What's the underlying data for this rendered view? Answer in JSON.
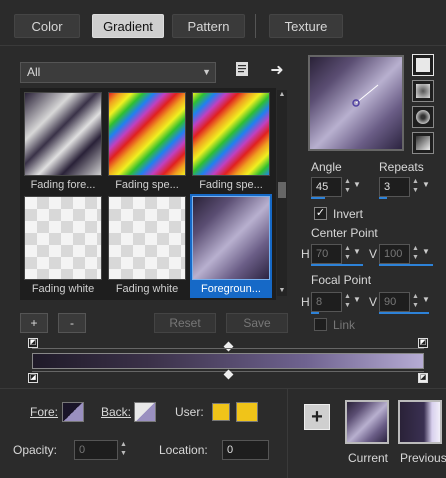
{
  "tabs": [
    "Color",
    "Gradient",
    "Pattern",
    "Texture"
  ],
  "active_tab": "Gradient",
  "dropdown": {
    "value": "All"
  },
  "thumbnails": [
    {
      "caption": "Fading fore...",
      "selected": false
    },
    {
      "caption": "Fading spe...",
      "selected": false
    },
    {
      "caption": "Fading spe...",
      "selected": false
    },
    {
      "caption": "Fading white",
      "selected": false
    },
    {
      "caption": "Fading white",
      "selected": false
    },
    {
      "caption": "Foregroun...",
      "selected": true
    }
  ],
  "buttons": {
    "add": "+",
    "remove": "-",
    "reset": "Reset",
    "save": "Save"
  },
  "angle": {
    "label": "Angle",
    "value": "45"
  },
  "repeats": {
    "label": "Repeats",
    "value": "3"
  },
  "invert": {
    "label": "Invert",
    "checked": true
  },
  "center_point": {
    "label": "Center Point",
    "h_label": "H",
    "h_value": "70",
    "v_label": "V",
    "v_value": "100"
  },
  "focal_point": {
    "label": "Focal Point",
    "h_label": "H",
    "h_value": "8",
    "v_label": "V",
    "v_value": "90"
  },
  "link": {
    "label": "Link",
    "checked": false
  },
  "bottom": {
    "fore_label": "Fore:",
    "back_label": "Back:",
    "user_label": "User:",
    "opacity_label": "Opacity:",
    "opacity_value": "0",
    "location_label": "Location:",
    "location_value": "0",
    "current_label": "Current",
    "previous_label": "Previous",
    "plus": "+"
  },
  "colors": {
    "accent": "#1669c7",
    "user_swatch": "#f0c419",
    "gradient_dark": "#1f1a28",
    "gradient_light": "#b6acd4"
  },
  "icons": [
    "notebook-icon",
    "arrow-right-icon",
    "chevron-down-icon",
    "chevron-up-icon"
  ]
}
